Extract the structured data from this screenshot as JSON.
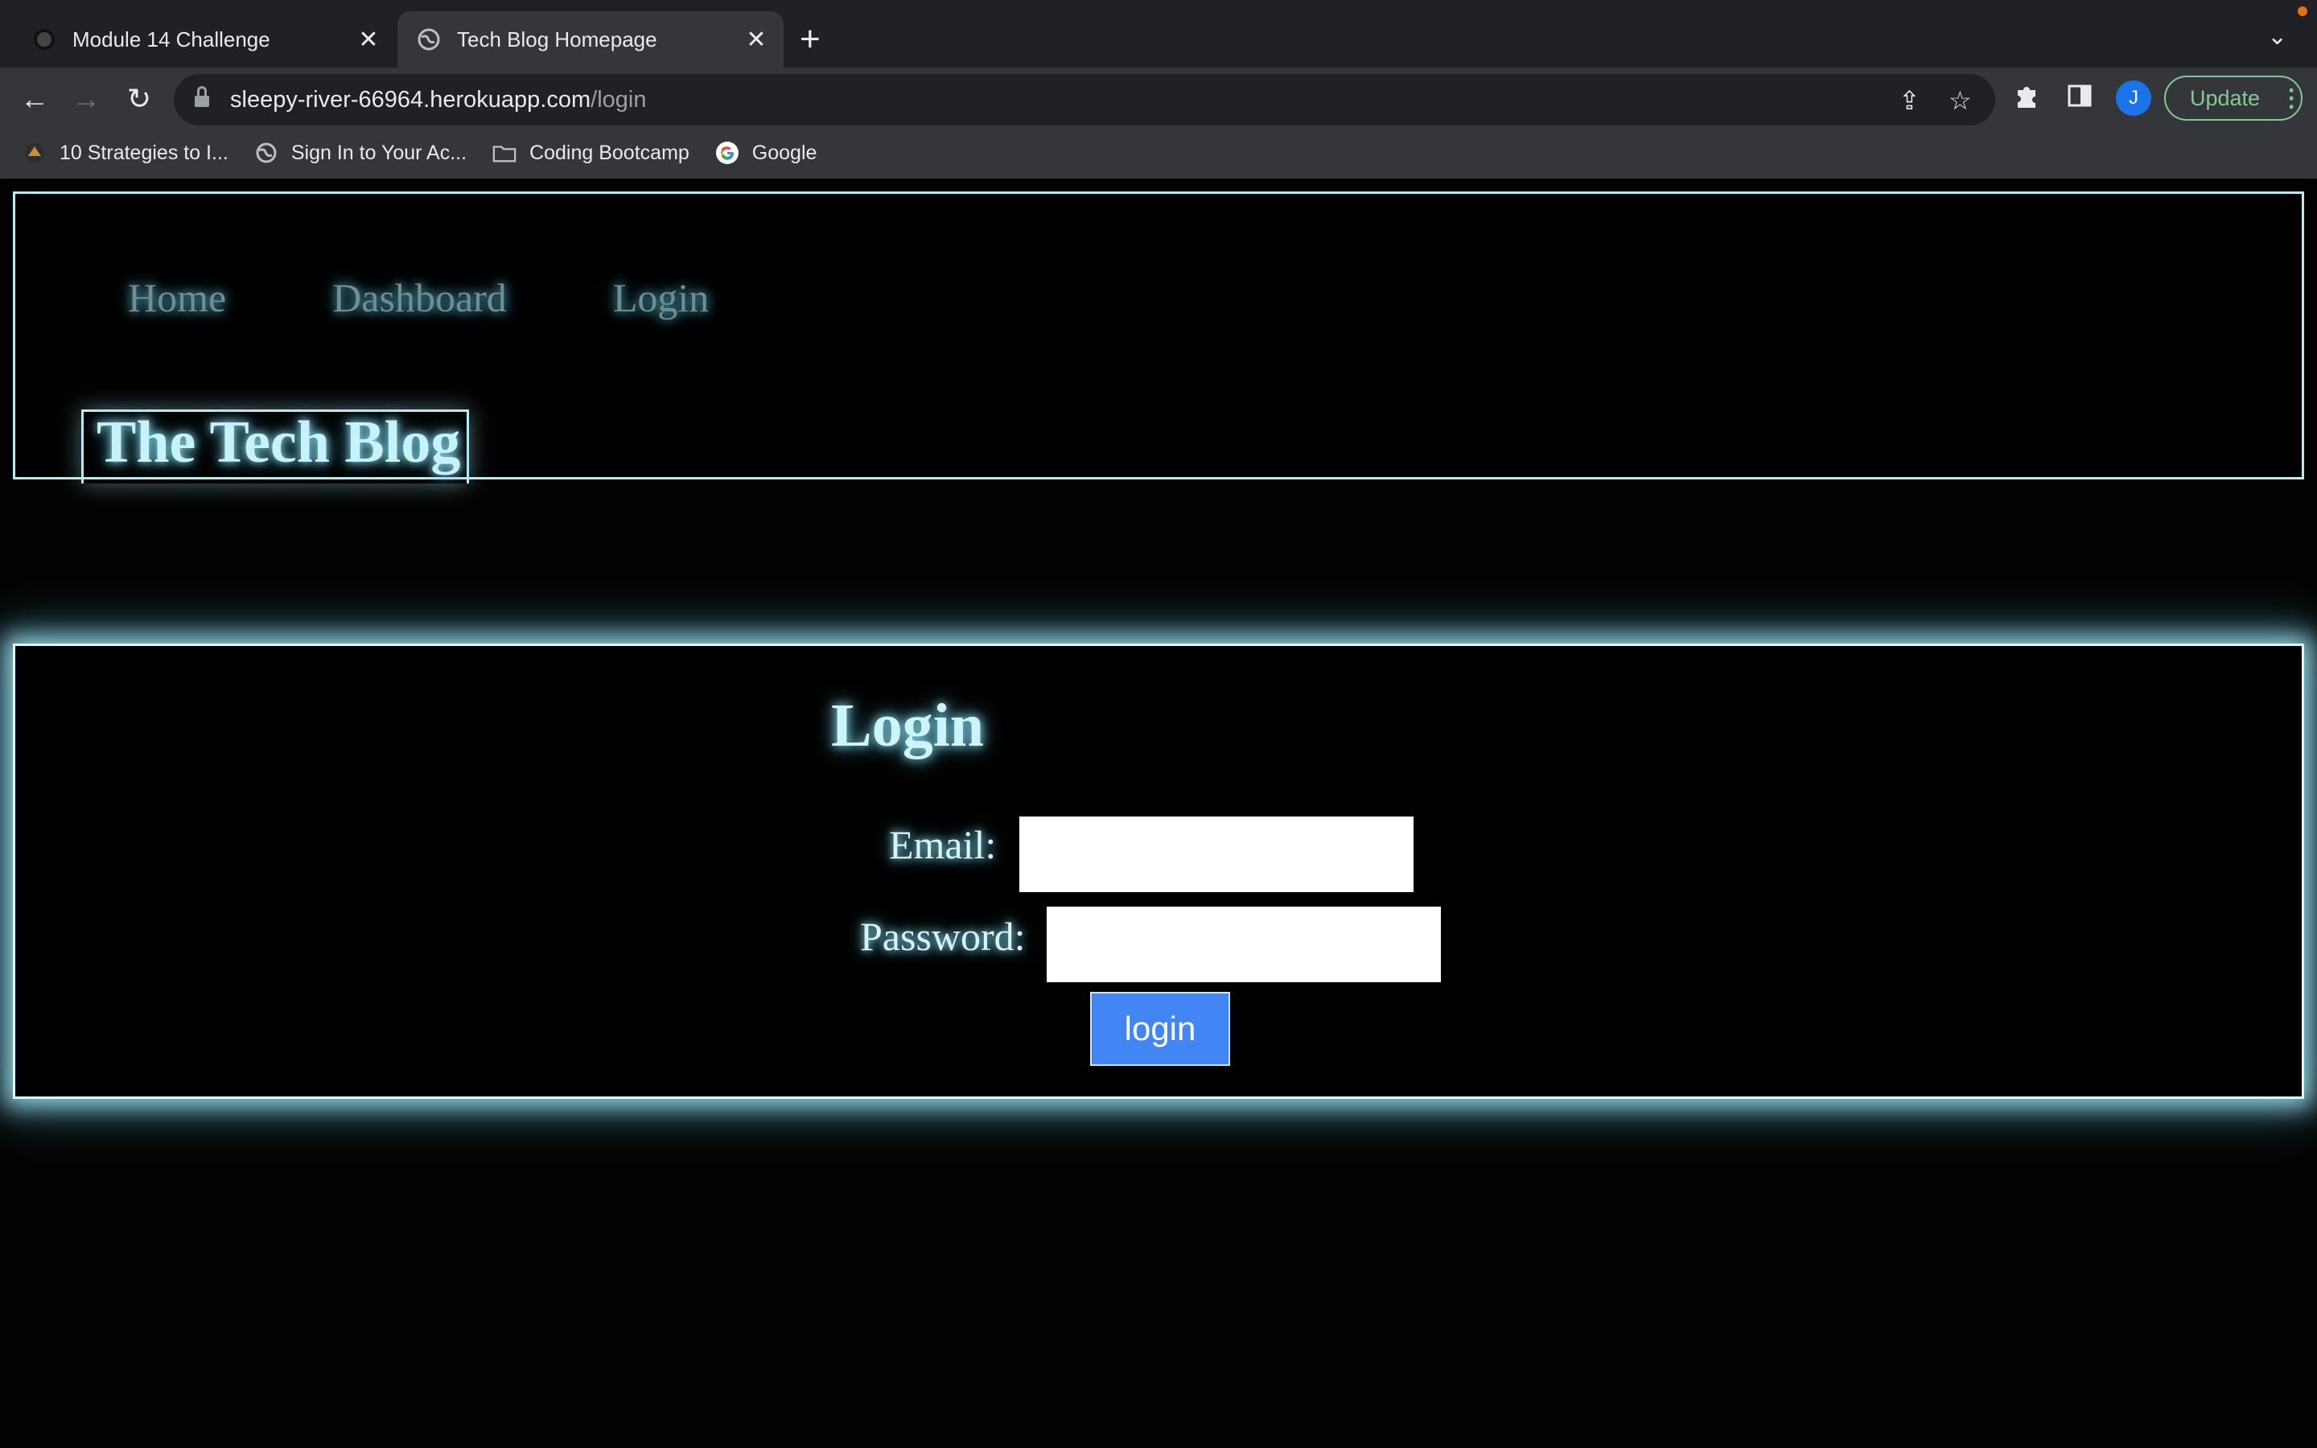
{
  "browser": {
    "tabs": [
      {
        "title": "Module 14 Challenge",
        "active": false,
        "icon": "github-icon"
      },
      {
        "title": "Tech Blog Homepage",
        "active": true,
        "icon": "globe-icon"
      }
    ],
    "new_tab": "+",
    "tab_close": "✕",
    "url": {
      "host": "sleepy-river-66964.herokuapp.com",
      "path": "/login"
    },
    "profile_initial": "J",
    "update_label": "Update",
    "bookmarks": [
      {
        "label": "10 Strategies to I...",
        "icon": "site-icon"
      },
      {
        "label": "Sign In to Your Ac...",
        "icon": "globe-icon"
      },
      {
        "label": "Coding Bootcamp",
        "icon": "folder-icon"
      },
      {
        "label": "Google",
        "icon": "google-icon"
      }
    ],
    "accent_color": "#81c995"
  },
  "nav": {
    "home": "Home",
    "dashboard": "Dashboard",
    "login": "Login"
  },
  "brand": {
    "title": "The Tech Blog"
  },
  "login": {
    "title": "Login",
    "email_label": "Email:",
    "email_value": "",
    "password_label": "Password:",
    "password_value": "",
    "submit_label": "login"
  },
  "colors": {
    "glow": "#8fd9ea",
    "button": "#4285f4",
    "background": "#000000"
  }
}
